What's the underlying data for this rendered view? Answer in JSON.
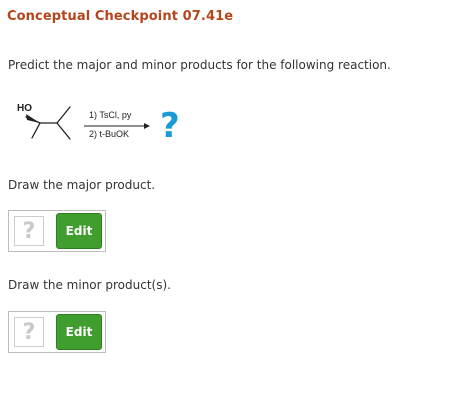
{
  "header": {
    "title": "Conceptual Checkpoint 07.41e"
  },
  "question": {
    "text": "Predict the major and minor products for the following reaction."
  },
  "reaction": {
    "substituent_label": "HO",
    "reagent_1": "1) TsCl, py",
    "reagent_2": "2) t-BuOK",
    "unknown_product_symbol": "?",
    "unknown_color": "#1a9bd7"
  },
  "major_section": {
    "prompt": "Draw the major product.",
    "placeholder_symbol": "?",
    "edit_label": "Edit"
  },
  "minor_section": {
    "prompt": "Draw the minor product(s).",
    "placeholder_symbol": "?",
    "edit_label": "Edit"
  },
  "colors": {
    "title": "#b5451b",
    "edit_button": "#3f9e2e"
  }
}
